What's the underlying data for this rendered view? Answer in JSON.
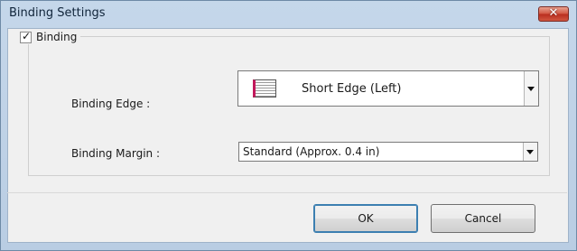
{
  "window": {
    "title": "Binding Settings",
    "close_label": "✕"
  },
  "binding_group": {
    "checkbox_checked": true,
    "checkbox_mark": "✓",
    "label": "Binding"
  },
  "binding_edge": {
    "label": "Binding Edge :",
    "value": "Short Edge (Left)",
    "icon": "book-binding-icon"
  },
  "binding_margin": {
    "label": "Binding Margin :",
    "value": "Standard (Approx. 0.4 in)"
  },
  "buttons": {
    "ok_label": "OK",
    "cancel_label": "Cancel"
  },
  "colors": {
    "title_bar": "#c5d7ea",
    "close_button": "#c7402c",
    "dialog_background": "#f0f0f0",
    "binding_accent": "#c2185b"
  }
}
